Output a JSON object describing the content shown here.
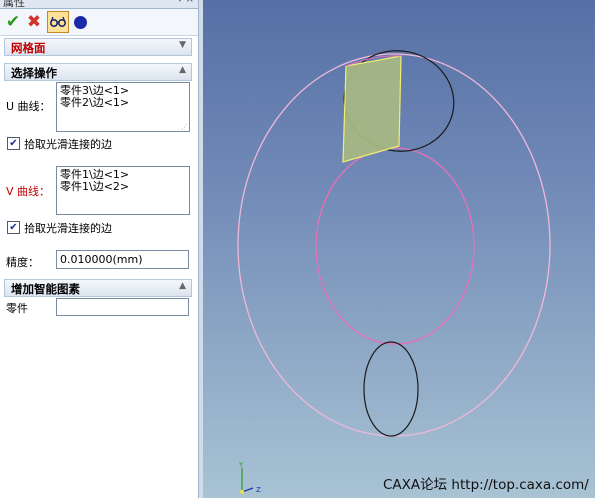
{
  "panel": {
    "title": "属性",
    "toolbar": {
      "ok_icon": "check-icon",
      "cancel_icon": "close-icon",
      "preview_icon": "glasses-icon",
      "options_icon": "circle-icon"
    },
    "mesh_section": {
      "title": "网格面"
    },
    "select_section": {
      "title": "选择操作",
      "u_curve": {
        "label": "U 曲线：",
        "items": [
          "零件3\\边<1>",
          "零件2\\边<1>"
        ]
      },
      "u_smooth": {
        "label": "拾取光滑连接的边",
        "checked": true
      },
      "v_curve": {
        "label": "V 曲线：",
        "items": [
          "零件1\\边<1>",
          "零件1\\边<2>"
        ]
      },
      "v_smooth": {
        "label": "拾取光滑连接的边",
        "checked": true
      },
      "precision": {
        "label": "精度：",
        "value": "0.010000(mm)"
      }
    },
    "smart_section": {
      "title": "增加智能图素",
      "part": {
        "label": "零件",
        "value": ""
      }
    }
  },
  "viewport": {
    "watermark": "CAXA论坛  http://top.caxa.com/",
    "axis_labels": {
      "y": "Y",
      "z": "Z"
    }
  },
  "colors": {
    "curve_outer": "#f0b8d8",
    "curve_dark": "#1a1a1a",
    "surface_fill": "#a8b882",
    "surface_edge": "#f0f070",
    "mesh_title": "#c00000"
  }
}
